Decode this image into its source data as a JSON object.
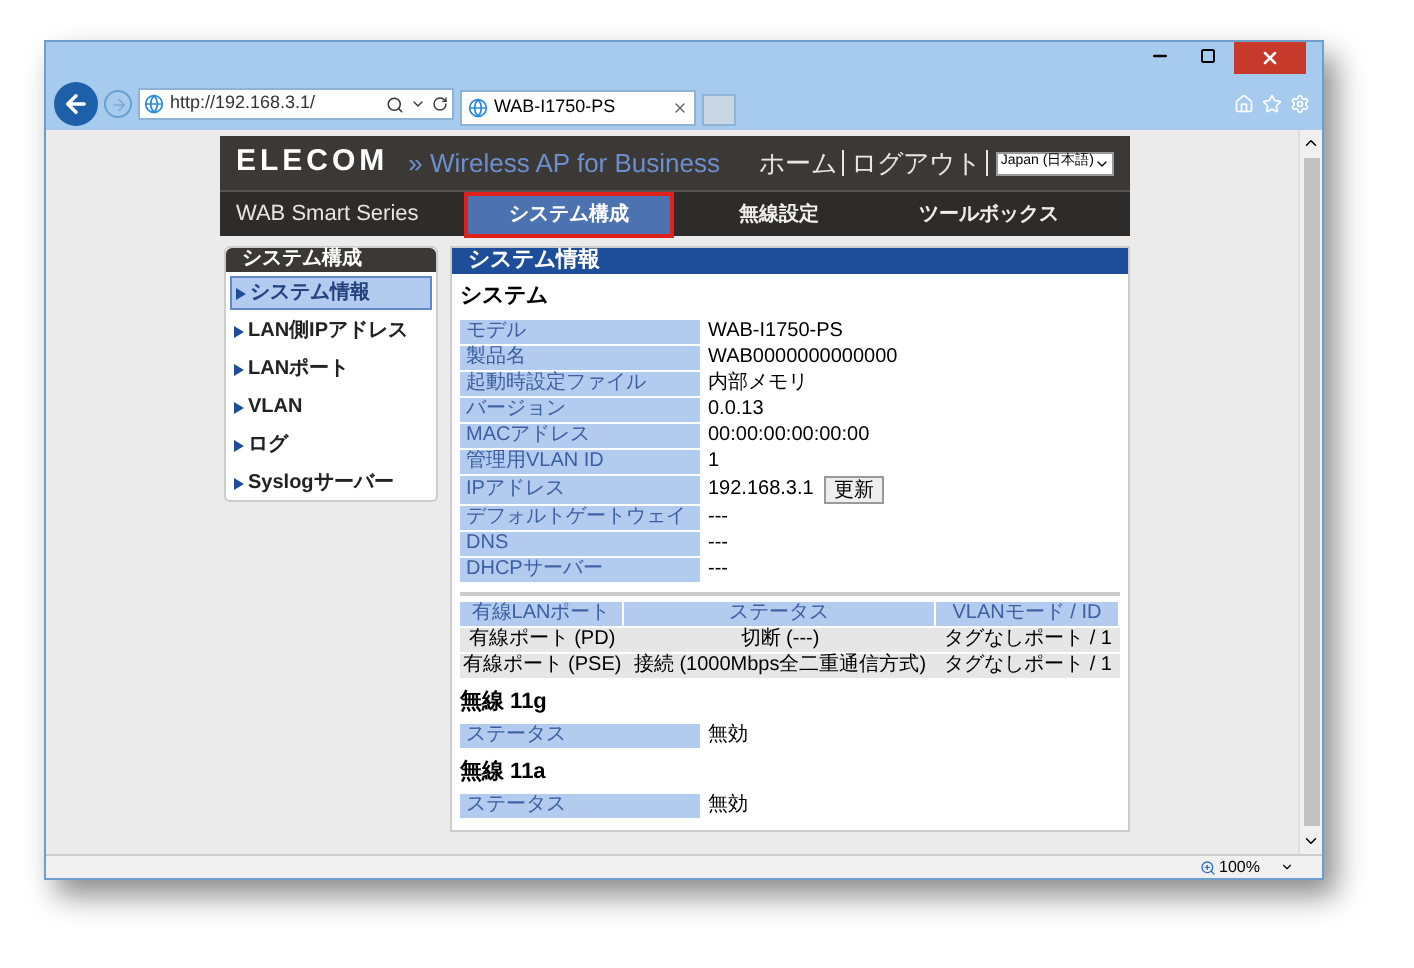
{
  "browser": {
    "address": "http://192.168.3.1/",
    "tab_title": "WAB-I1750-PS",
    "zoom": "100%"
  },
  "header": {
    "brand": "ELECOM",
    "product": "» Wireless AP for Business",
    "links": [
      "ホーム",
      "ログアウト"
    ],
    "language": "Japan (日本語)",
    "series": "WAB Smart Series"
  },
  "nav_tabs": [
    {
      "label": "システム構成",
      "selected": true
    },
    {
      "label": "無線設定",
      "selected": false
    },
    {
      "label": "ツールボックス",
      "selected": false
    }
  ],
  "sidebar": {
    "title": "システム構成",
    "items": [
      {
        "label": "システム情報",
        "selected": true
      },
      {
        "label": "LAN側IPアドレス",
        "selected": false
      },
      {
        "label": "LANポート",
        "selected": false
      },
      {
        "label": "VLAN",
        "selected": false
      },
      {
        "label": "ログ",
        "selected": false
      },
      {
        "label": "Syslogサーバー",
        "selected": false
      }
    ]
  },
  "panel": {
    "title": "システム情報",
    "section": "システム",
    "rows": [
      {
        "label": "モデル",
        "value": "WAB-I1750-PS",
        "kind": "text"
      },
      {
        "label": "製品名",
        "value": "WAB0000000000000",
        "kind": "text"
      },
      {
        "label": "起動時設定ファイル",
        "value": "内部メモリ",
        "kind": "text"
      },
      {
        "label": "バージョン",
        "value": "0.0.13",
        "kind": "text"
      },
      {
        "label": "MACアドレス",
        "value": "00:00:00:00:00:00",
        "kind": "text"
      },
      {
        "label": "管理用VLAN ID",
        "value": "1",
        "kind": "text"
      },
      {
        "label": "IPアドレス",
        "value": "192.168.3.1",
        "kind": "button",
        "button": "更新"
      },
      {
        "label": "デフォルトゲートウェイ",
        "value": "---",
        "kind": "text"
      },
      {
        "label": "DNS",
        "value": "---",
        "kind": "text"
      },
      {
        "label": "DHCPサーバー",
        "value": "---",
        "kind": "text"
      }
    ],
    "port_table": {
      "columns": [
        "有線LANポート",
        "ステータス",
        "VLANモード / ID"
      ],
      "rows": [
        [
          "有線ポート (PD)",
          "切断 (---)",
          "タグなしポート / 1"
        ],
        [
          "有線ポート (PSE)",
          "接続 (1000Mbps全二重通信方式)",
          "タグなしポート / 1"
        ]
      ]
    },
    "wireless": [
      {
        "title": "無線 11g",
        "label": "ステータス",
        "value": "無効"
      },
      {
        "title": "無線 11a",
        "label": "ステータス",
        "value": "無効"
      }
    ]
  }
}
